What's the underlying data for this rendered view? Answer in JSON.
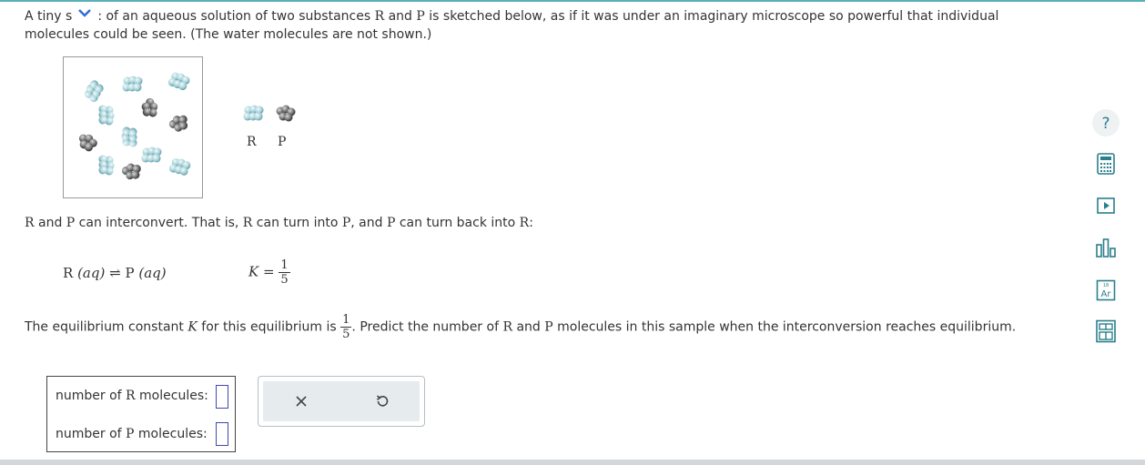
{
  "intro": {
    "part1": "A tiny s",
    "part2": " of an aqueous solution of two substances ",
    "r": "R",
    "and": " and ",
    "p": "P",
    "part3": " is sketched below, as if it was under an imaginary microscope so powerful that individual",
    "line2": "molecules could be seen. (The water molecules are not shown.)"
  },
  "legend": {
    "r_label": "R",
    "p_label": "P"
  },
  "interconvert": {
    "r1": "R",
    "t1": " and ",
    "p1": "P",
    "t2": " can interconvert. That is, ",
    "r2": "R",
    "t3": " can turn into ",
    "p2": "P",
    "t4": ", and ",
    "p3": "P",
    "t5": " can turn back into ",
    "r3": "R",
    "t6": ":"
  },
  "equation": {
    "left": "R",
    "left_phase": "(aq)",
    "arrow": "⇌",
    "right": "P",
    "right_phase": "(aq)"
  },
  "k_expr": {
    "symbol": "K",
    "equals": "=",
    "num": "1",
    "den": "5"
  },
  "question": {
    "t1": "The equilibrium constant ",
    "k": "K",
    "t2": " for this equilibrium is ",
    "num": "1",
    "den": "5",
    "t3": ". Predict the number of ",
    "r": "R",
    "t4": " and ",
    "p": "P",
    "t5": " molecules in this sample when the interconversion reaches equilibrium."
  },
  "answers": {
    "r_label_pre": "number of ",
    "r_sym": "R",
    "r_label_post": " molecules:",
    "p_label_pre": "number of ",
    "p_sym": "P",
    "p_label_post": " molecules:",
    "r_value": "",
    "p_value": ""
  },
  "buttons": {
    "clear_symbol": "×",
    "undo_symbol": "↺"
  },
  "tools": {
    "help_symbol": "?",
    "periodic_label": "Ar",
    "periodic_number": "18"
  },
  "colors": {
    "r_molecule": "#a9d3da",
    "p_molecule": "#7b7b7b",
    "accent": "#3f48b0",
    "teal": "#2a7f8c"
  },
  "icons": [
    "chevron-down-icon",
    "help-icon",
    "calculator-icon",
    "video-icon",
    "chart-icon",
    "periodic-table-icon",
    "data-icon",
    "close-icon",
    "undo-icon"
  ]
}
